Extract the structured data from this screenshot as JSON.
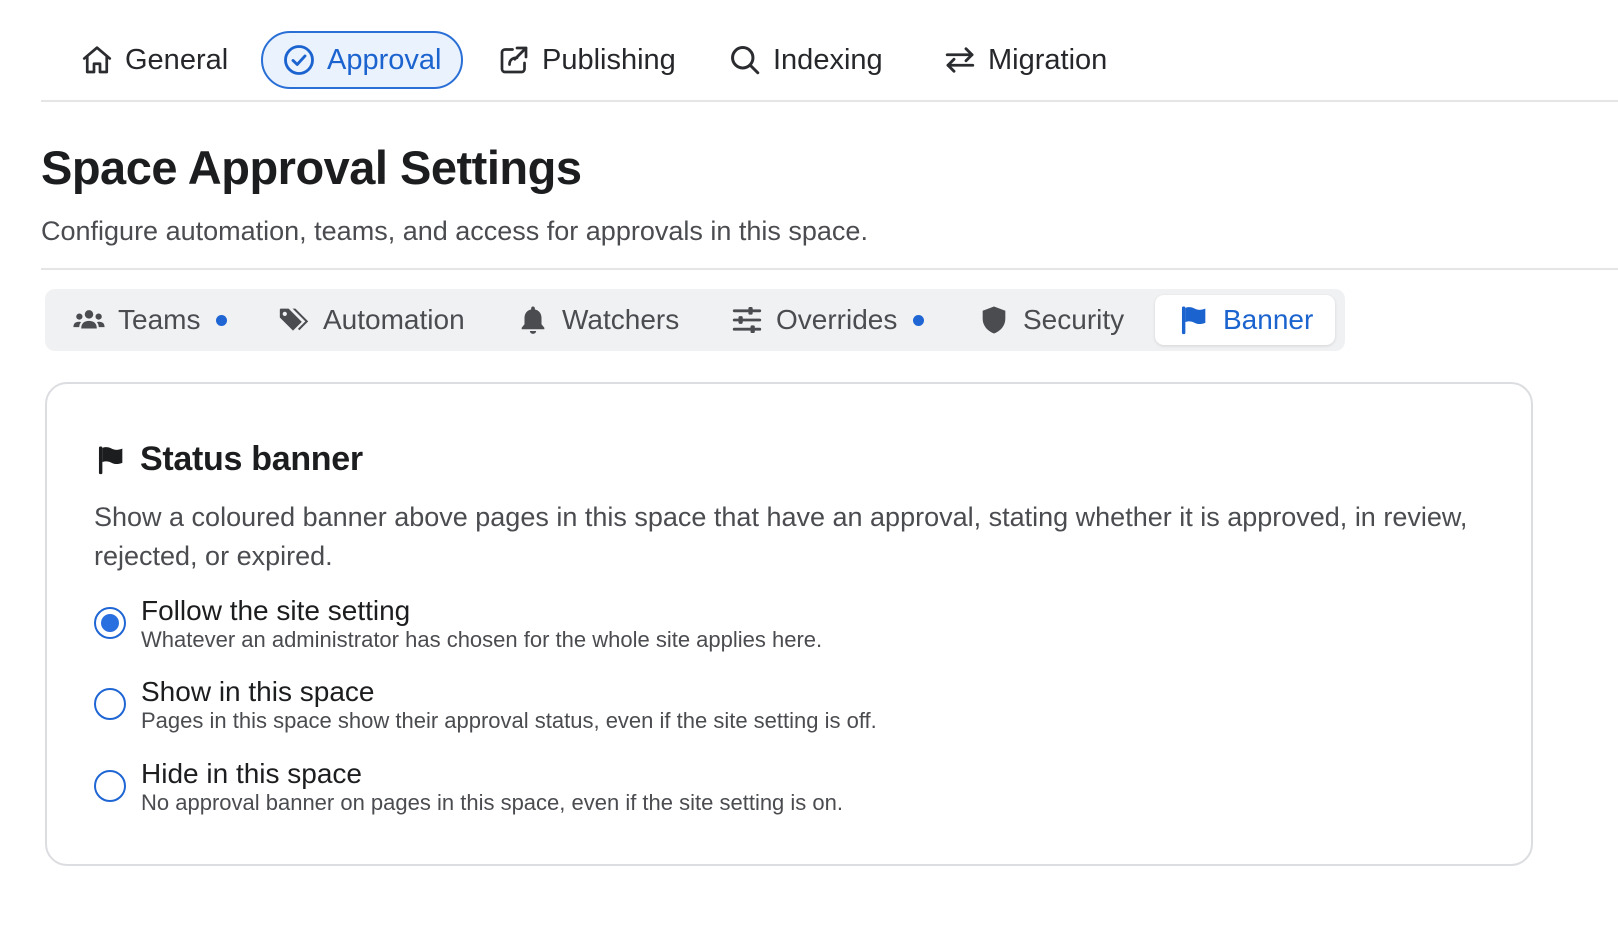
{
  "top_nav": {
    "items": [
      {
        "label": "General",
        "icon": "home-icon"
      },
      {
        "label": "Approval",
        "icon": "check-circle-icon",
        "active": true
      },
      {
        "label": "Publishing",
        "icon": "share-icon"
      },
      {
        "label": "Indexing",
        "icon": "search-icon"
      },
      {
        "label": "Migration",
        "icon": "swap-arrows-icon"
      }
    ]
  },
  "header": {
    "title": "Space Approval Settings",
    "description": "Configure automation, teams, and access for approvals in this space."
  },
  "subtabs": {
    "items": [
      {
        "label": "Teams",
        "icon": "users-icon",
        "has_dot": true
      },
      {
        "label": "Automation",
        "icon": "tags-icon",
        "has_dot": false
      },
      {
        "label": "Watchers",
        "icon": "bell-icon",
        "has_dot": false
      },
      {
        "label": "Overrides",
        "icon": "sliders-icon",
        "has_dot": true
      },
      {
        "label": "Security",
        "icon": "shield-icon",
        "has_dot": false
      },
      {
        "label": "Banner",
        "icon": "flag-icon",
        "has_dot": false,
        "active": true
      }
    ]
  },
  "banner_card": {
    "title": "Status banner",
    "description": "Show a coloured banner above pages in this space that have an approval, stating whether it is approved, in review, rejected, or expired.",
    "options": [
      {
        "label": "Follow the site setting",
        "help": "Whatever an administrator has chosen for the whole site applies here.",
        "checked": true
      },
      {
        "label": "Show in this space",
        "help": "Pages in this space show their approval status, even if the site setting is off.",
        "checked": false
      },
      {
        "label": "Hide in this space",
        "help": "No approval banner on pages in this space, even if the site setting is on.",
        "checked": false
      }
    ]
  },
  "colors": {
    "accent": "#1f66d4",
    "active_bg": "#eaf2fd",
    "subtab_bg": "#f0f1f3",
    "dot": "#1f66d4"
  }
}
